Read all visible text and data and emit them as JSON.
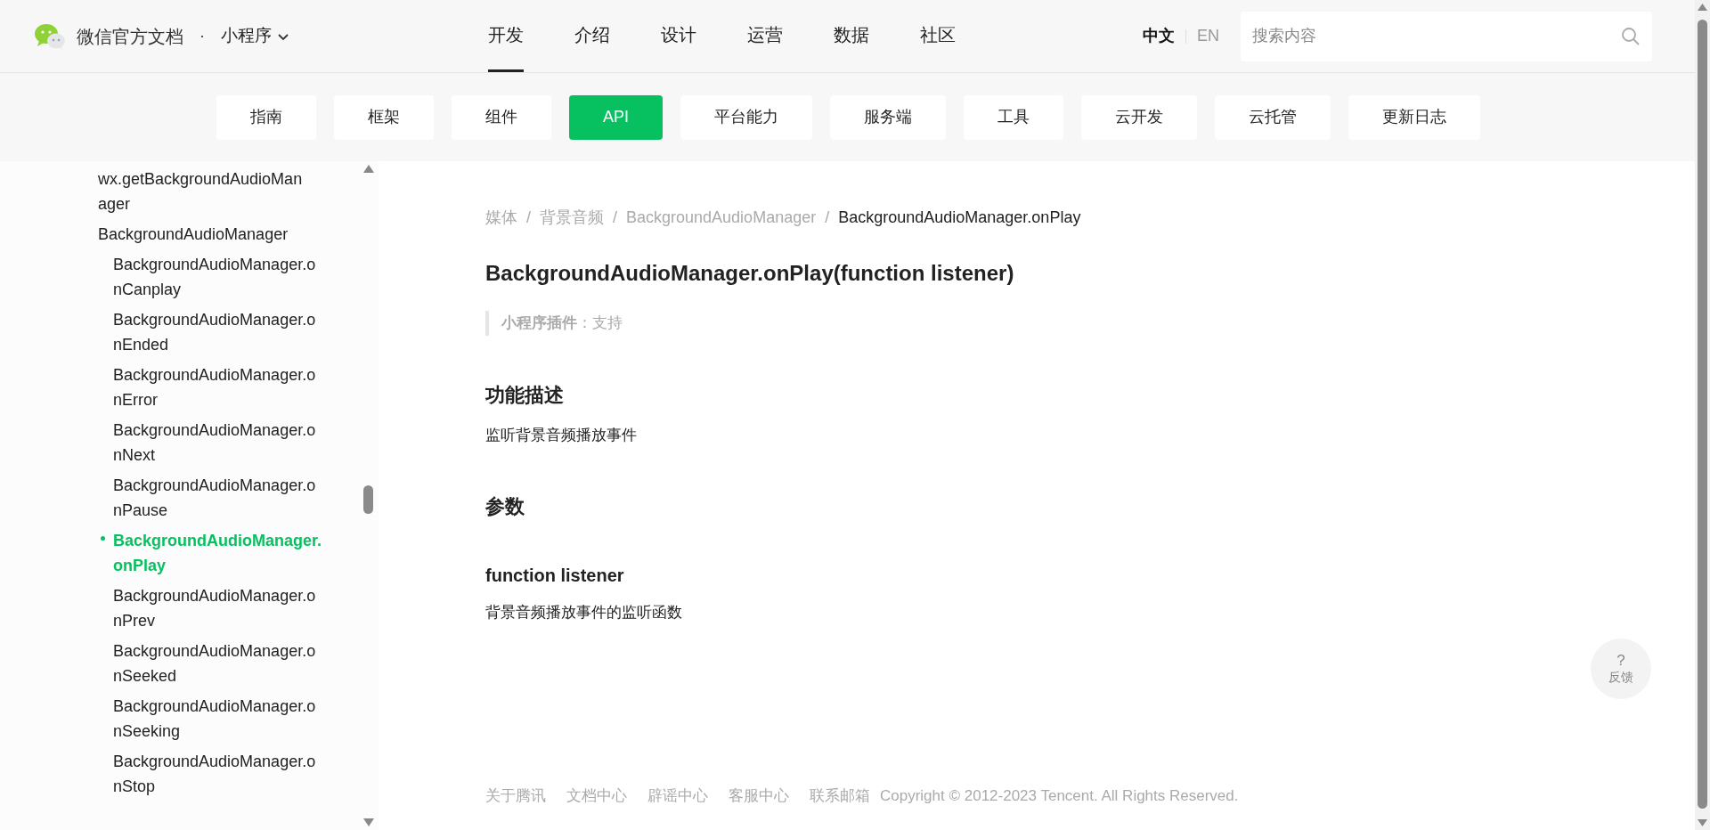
{
  "header": {
    "site_title": "微信官方文档",
    "dot": "·",
    "product": "小程序",
    "nav": [
      {
        "label": "开发",
        "selected": true
      },
      {
        "label": "介绍",
        "selected": false
      },
      {
        "label": "设计",
        "selected": false
      },
      {
        "label": "运营",
        "selected": false
      },
      {
        "label": "数据",
        "selected": false
      },
      {
        "label": "社区",
        "selected": false
      }
    ],
    "languages": [
      {
        "label": "中文",
        "selected": true
      },
      {
        "label": "EN",
        "selected": false
      }
    ],
    "search": {
      "placeholder": "搜索内容"
    }
  },
  "subnav": [
    {
      "label": "指南",
      "selected": false
    },
    {
      "label": "框架",
      "selected": false
    },
    {
      "label": "组件",
      "selected": false
    },
    {
      "label": "API",
      "selected": true
    },
    {
      "label": "平台能力",
      "selected": false
    },
    {
      "label": "服务端",
      "selected": false
    },
    {
      "label": "工具",
      "selected": false
    },
    {
      "label": "云开发",
      "selected": false
    },
    {
      "label": "云托管",
      "selected": false
    },
    {
      "label": "更新日志",
      "selected": false
    }
  ],
  "sidebar": {
    "items": [
      {
        "label": "wx.getBackgroundAudioManager",
        "selected": false
      },
      {
        "label": "BackgroundAudioManager",
        "selected": false,
        "children": [
          {
            "label": "BackgroundAudioManager.onCanplay",
            "selected": false
          },
          {
            "label": "BackgroundAudioManager.onEnded",
            "selected": false
          },
          {
            "label": "BackgroundAudioManager.onError",
            "selected": false
          },
          {
            "label": "BackgroundAudioManager.onNext",
            "selected": false
          },
          {
            "label": "BackgroundAudioManager.onPause",
            "selected": false
          },
          {
            "label": "BackgroundAudioManager.onPlay",
            "selected": true
          },
          {
            "label": "BackgroundAudioManager.onPrev",
            "selected": false
          },
          {
            "label": "BackgroundAudioManager.onSeeked",
            "selected": false
          },
          {
            "label": "BackgroundAudioManager.onSeeking",
            "selected": false
          },
          {
            "label": "BackgroundAudioManager.onStop",
            "selected": false
          }
        ]
      }
    ]
  },
  "breadcrumb": {
    "separator": "/",
    "items": [
      "媒体",
      "背景音频",
      "BackgroundAudioManager",
      "BackgroundAudioManager.onPlay"
    ]
  },
  "article": {
    "title": "BackgroundAudioManager.onPlay(function listener)",
    "support_note": "**小程序插件**：支持",
    "sections": [
      {
        "heading": "功能描述",
        "text": "监听背景音频播放事件"
      },
      {
        "heading": "参数",
        "params": [
          {
            "name": "function listener",
            "text": "背景音频播放事件的监听函数"
          }
        ]
      }
    ]
  },
  "footer": {
    "links": [
      "关于腾讯",
      "文档中心",
      "辟谣中心",
      "客服中心",
      "联系邮箱"
    ],
    "copyright": "Copyright © 2012-2023 Tencent. All Rights Reserved."
  },
  "feedback": {
    "symbol": "?",
    "label": "反馈"
  }
}
